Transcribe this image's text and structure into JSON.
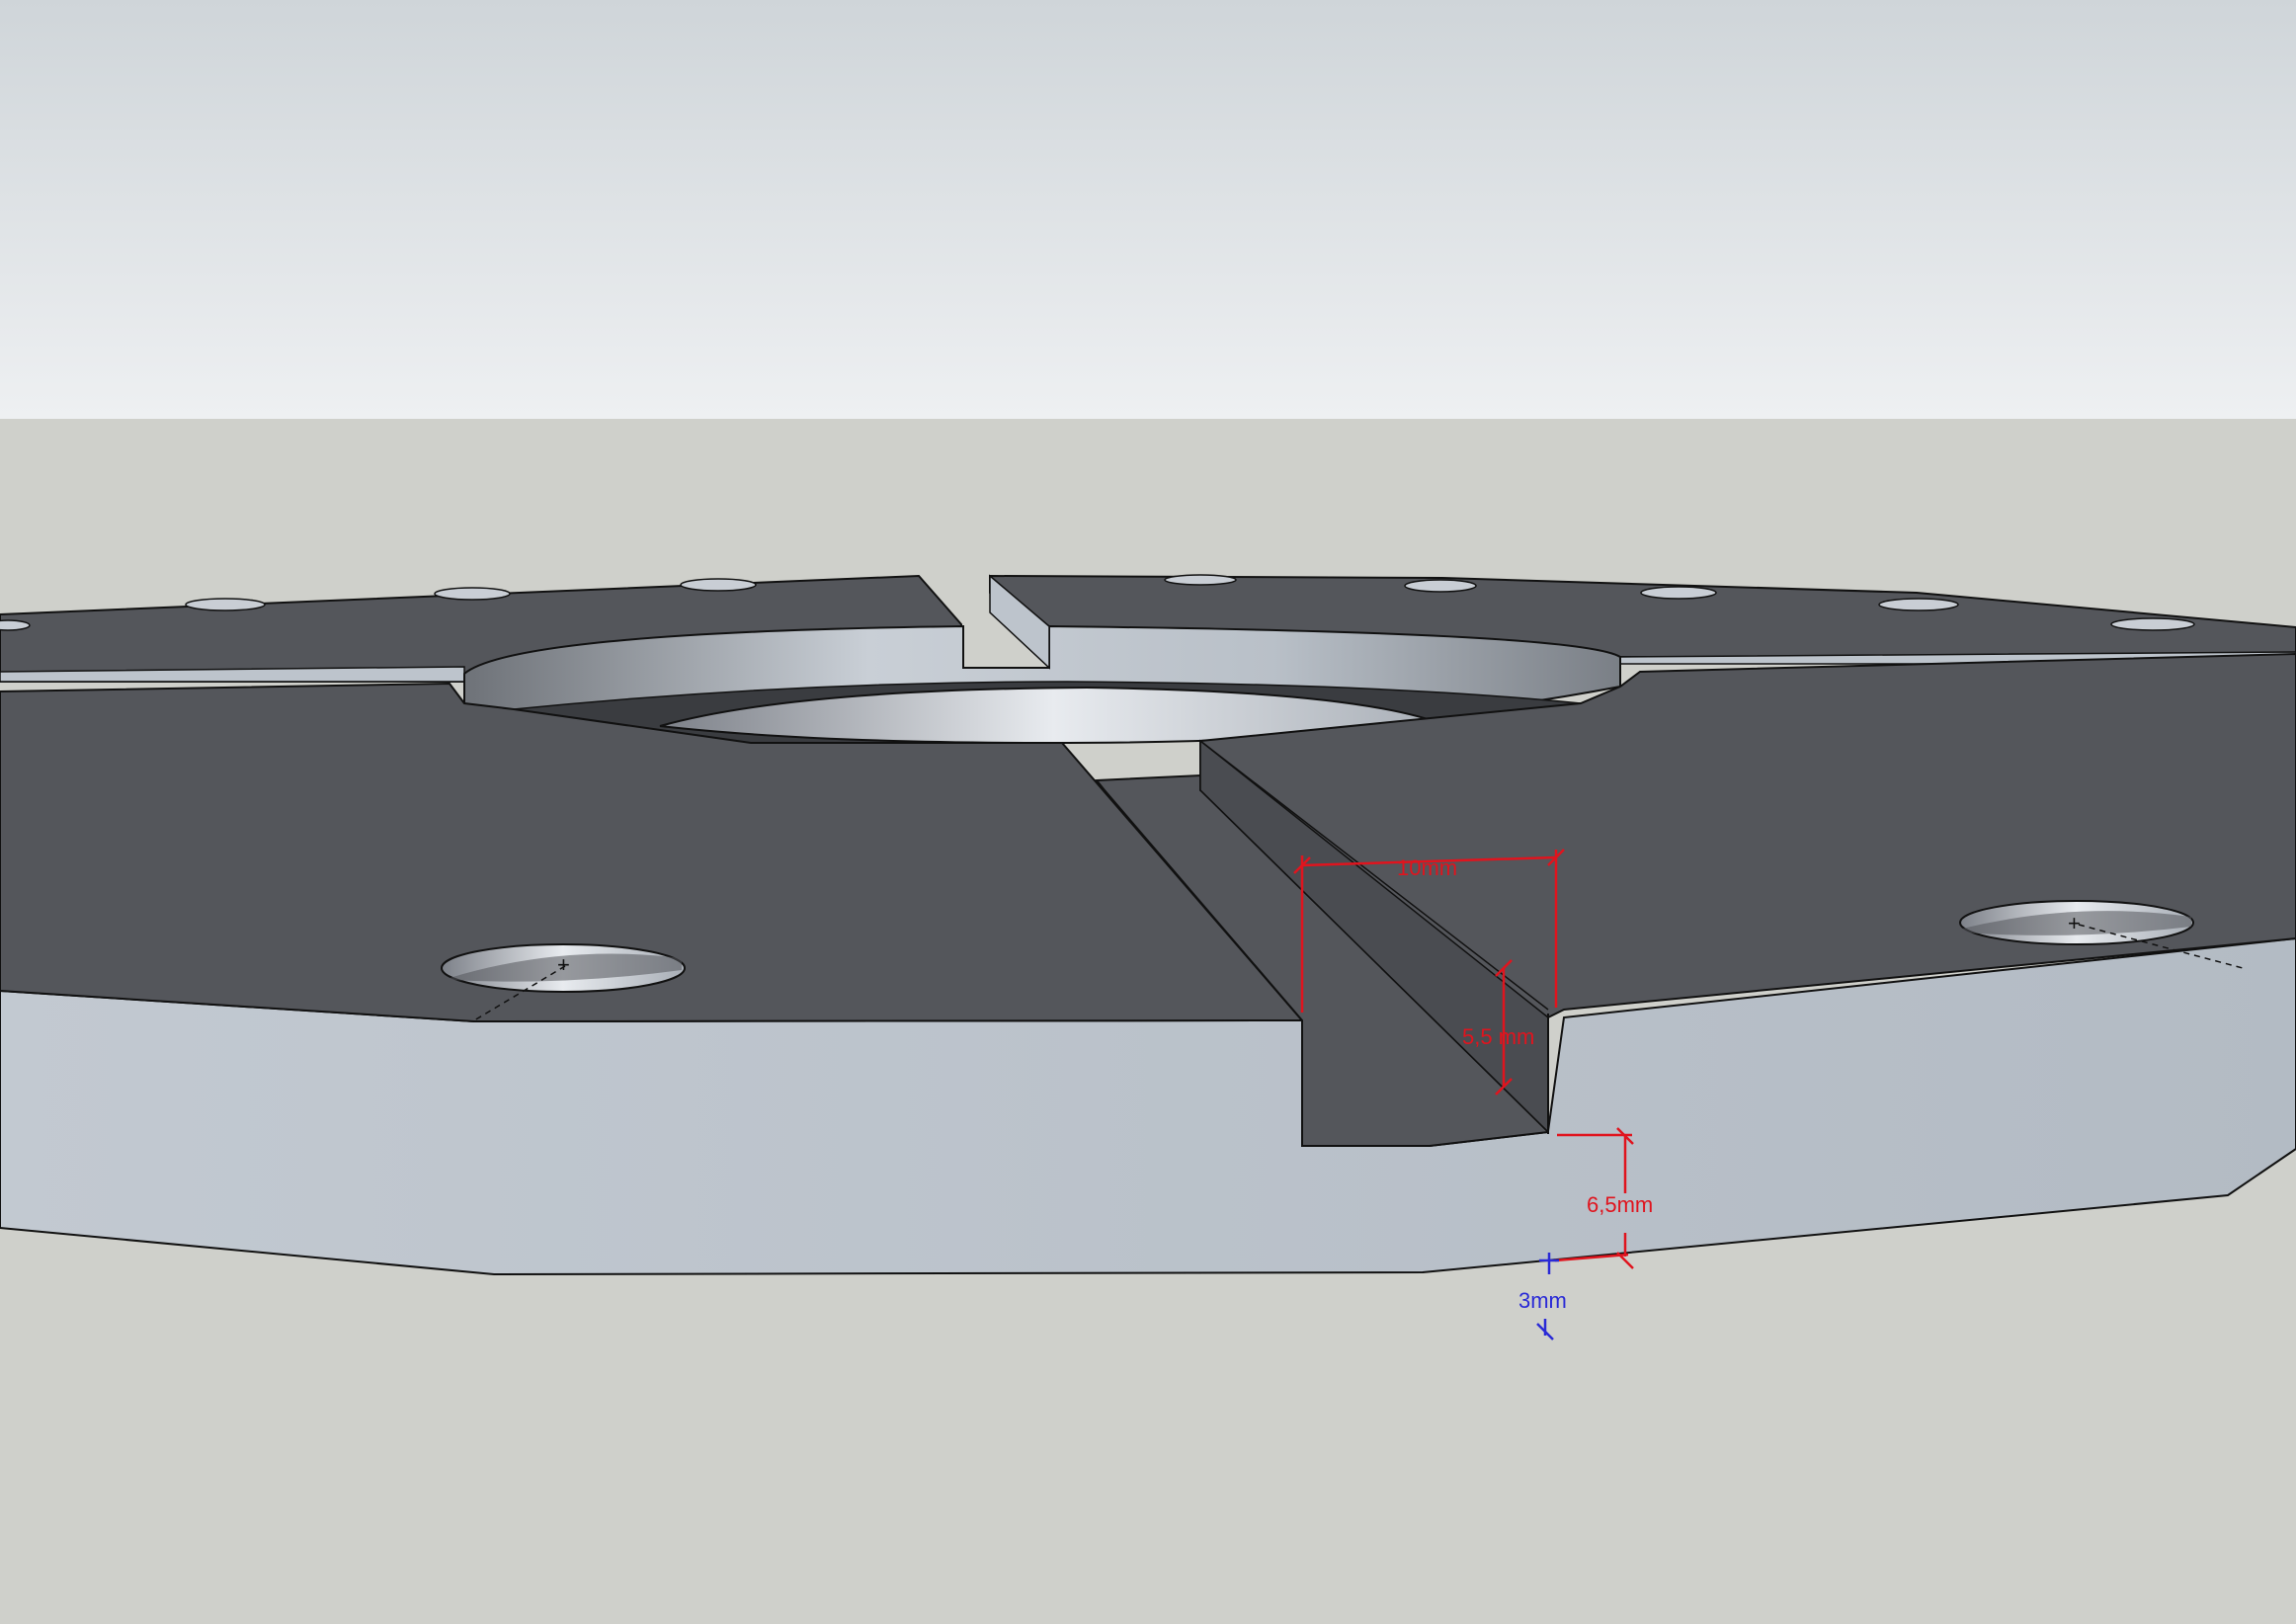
{
  "dimensions": {
    "width_top": "10mm",
    "depth_slot": "5,5 mm",
    "height_side": "6,5mm",
    "offset_bottom": "3mm"
  },
  "colors": {
    "sky_top": "#cfd5d9",
    "sky_bottom": "#eef0f2",
    "ground": "#cfd0cb",
    "top_face": "#54565b",
    "side_face": "#bdc4cc",
    "dimension_red": "#e0141e",
    "dimension_blue": "#2a2ad6"
  }
}
